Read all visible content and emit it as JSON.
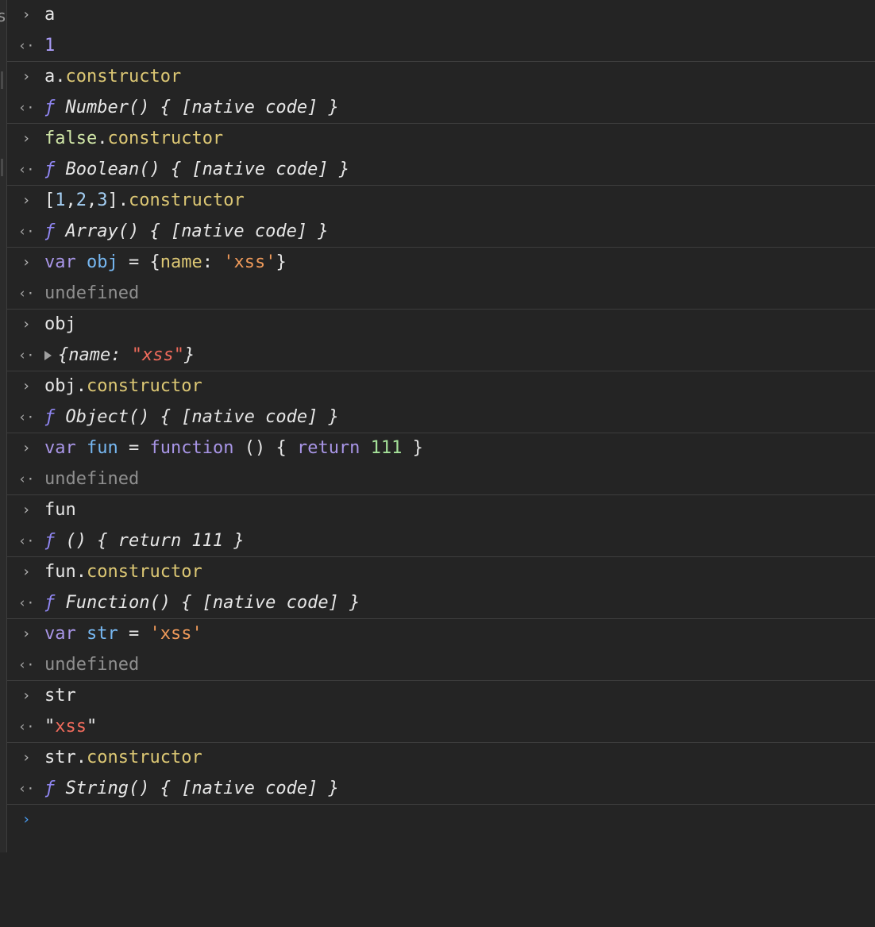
{
  "colors": {
    "background": "#242424",
    "property": "#dcc774",
    "keyword": "#a895e6",
    "variable": "#77b8f2",
    "string_literal": "#ef9a5a",
    "string_value": "#f06b5c",
    "undefined": "#8f8f8f",
    "function_symbol": "#9086f2",
    "active_prompt": "#4a9ef5"
  },
  "icons": {
    "input_prompt": "›",
    "output_prompt": "‹·",
    "expand": "triangle-right-icon"
  },
  "left_strip": {
    "edge_char": "s"
  },
  "entries": [
    {
      "input": "a",
      "output": "1"
    },
    {
      "input": {
        "obj": "a",
        "dot": ".",
        "prop": "constructor"
      },
      "output": {
        "f": "ƒ",
        "body": " Number() { [native code] }"
      }
    },
    {
      "input": {
        "obj": "false",
        "dot": ".",
        "prop": "constructor"
      },
      "output": {
        "f": "ƒ",
        "body": " Boolean() { [native code] }"
      }
    },
    {
      "input": {
        "open": "[",
        "n1": "1",
        "c1": ",",
        "n2": "2",
        "c2": ",",
        "n3": "3",
        "close": "]",
        "dot": ".",
        "prop": "constructor"
      },
      "output": {
        "f": "ƒ",
        "body": " Array() { [native code] }"
      }
    },
    {
      "input": {
        "kw": "var",
        "name": "obj",
        "eq": " = ",
        "open": "{",
        "key": "name",
        "colon": ": ",
        "str": "'xss'",
        "close": "}"
      },
      "output": "undefined"
    },
    {
      "input": "obj",
      "output": {
        "open": "{",
        "key": "name",
        "colon": ": ",
        "q1": "\"",
        "str": "xss",
        "q2": "\"",
        "close": "}"
      }
    },
    {
      "input": {
        "obj": "obj",
        "dot": ".",
        "prop": "constructor"
      },
      "output": {
        "f": "ƒ",
        "body": " Object() { [native code] }"
      }
    },
    {
      "input": {
        "kw": "var",
        "name": "fun",
        "eq": " = ",
        "kw2": "function",
        "paren": " () { ",
        "kw3": "return",
        "num": "111",
        "close": " }"
      },
      "output": "undefined"
    },
    {
      "input": "fun",
      "output": {
        "f": "ƒ",
        "body": " () { return 111 }"
      }
    },
    {
      "input": {
        "obj": "fun",
        "dot": ".",
        "prop": "constructor"
      },
      "output": {
        "f": "ƒ",
        "body": " Function() { [native code] }"
      }
    },
    {
      "input": {
        "kw": "var",
        "name": "str",
        "eq": " = ",
        "str": "'xss'"
      },
      "output": "undefined"
    },
    {
      "input": "str",
      "output": {
        "q1": "\"",
        "str": "xss",
        "q2": "\""
      }
    },
    {
      "input": {
        "obj": "str",
        "dot": ".",
        "prop": "constructor"
      },
      "output": {
        "f": "ƒ",
        "body": " String() { [native code] }"
      }
    }
  ],
  "active_prompt": "›"
}
